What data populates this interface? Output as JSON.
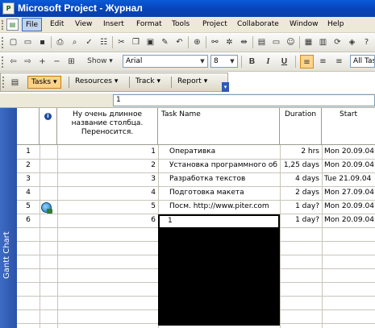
{
  "window": {
    "title": "Microsoft Project - Журнал",
    "app_icon": "project-app-icon"
  },
  "menubar": {
    "items": [
      "File",
      "Edit",
      "View",
      "Insert",
      "Format",
      "Tools",
      "Project",
      "Collaborate",
      "Window",
      "Help"
    ],
    "active_index": 0
  },
  "formatting_toolbar": {
    "show_label": "Show ▾",
    "font": "Arial",
    "size": "8",
    "bold": "B",
    "italic": "I",
    "underline": "U",
    "filter": "All Tas"
  },
  "project_guide": {
    "items": [
      "Tasks",
      "Resources",
      "Track",
      "Report"
    ],
    "active_index": 0
  },
  "entry_bar": {
    "value": "1"
  },
  "view_bar": {
    "label": "Gantt Chart"
  },
  "table": {
    "columns": {
      "indicators_icon": "i",
      "custom": "Ну очень длинное название столбца. Переносится.",
      "task_name": "Task Name",
      "duration": "Duration",
      "start": "Start"
    },
    "rows": [
      {
        "id": "1",
        "custom": "1",
        "name": "Оперативка",
        "duration": "2 hrs",
        "start": "Mon 20.09.04"
      },
      {
        "id": "2",
        "custom": "2",
        "name": "Установка программного об",
        "duration": "1,25 days",
        "start": "Mon 20.09.04"
      },
      {
        "id": "3",
        "custom": "3",
        "name": "Разработка текстов",
        "duration": "4 days",
        "start": "Tue 21.09.04"
      },
      {
        "id": "4",
        "custom": "4",
        "name": "Подготовка макета",
        "duration": "2 days",
        "start": "Mon 27.09.04"
      },
      {
        "id": "5",
        "custom": "5",
        "name": "Посм. http://www.piter.com",
        "duration": "1 day?",
        "start": "Mon 20.09.04"
      },
      {
        "id": "6",
        "custom": "6",
        "name": "1",
        "duration": "1 day?",
        "start": "Mon 20.09.04"
      }
    ]
  }
}
